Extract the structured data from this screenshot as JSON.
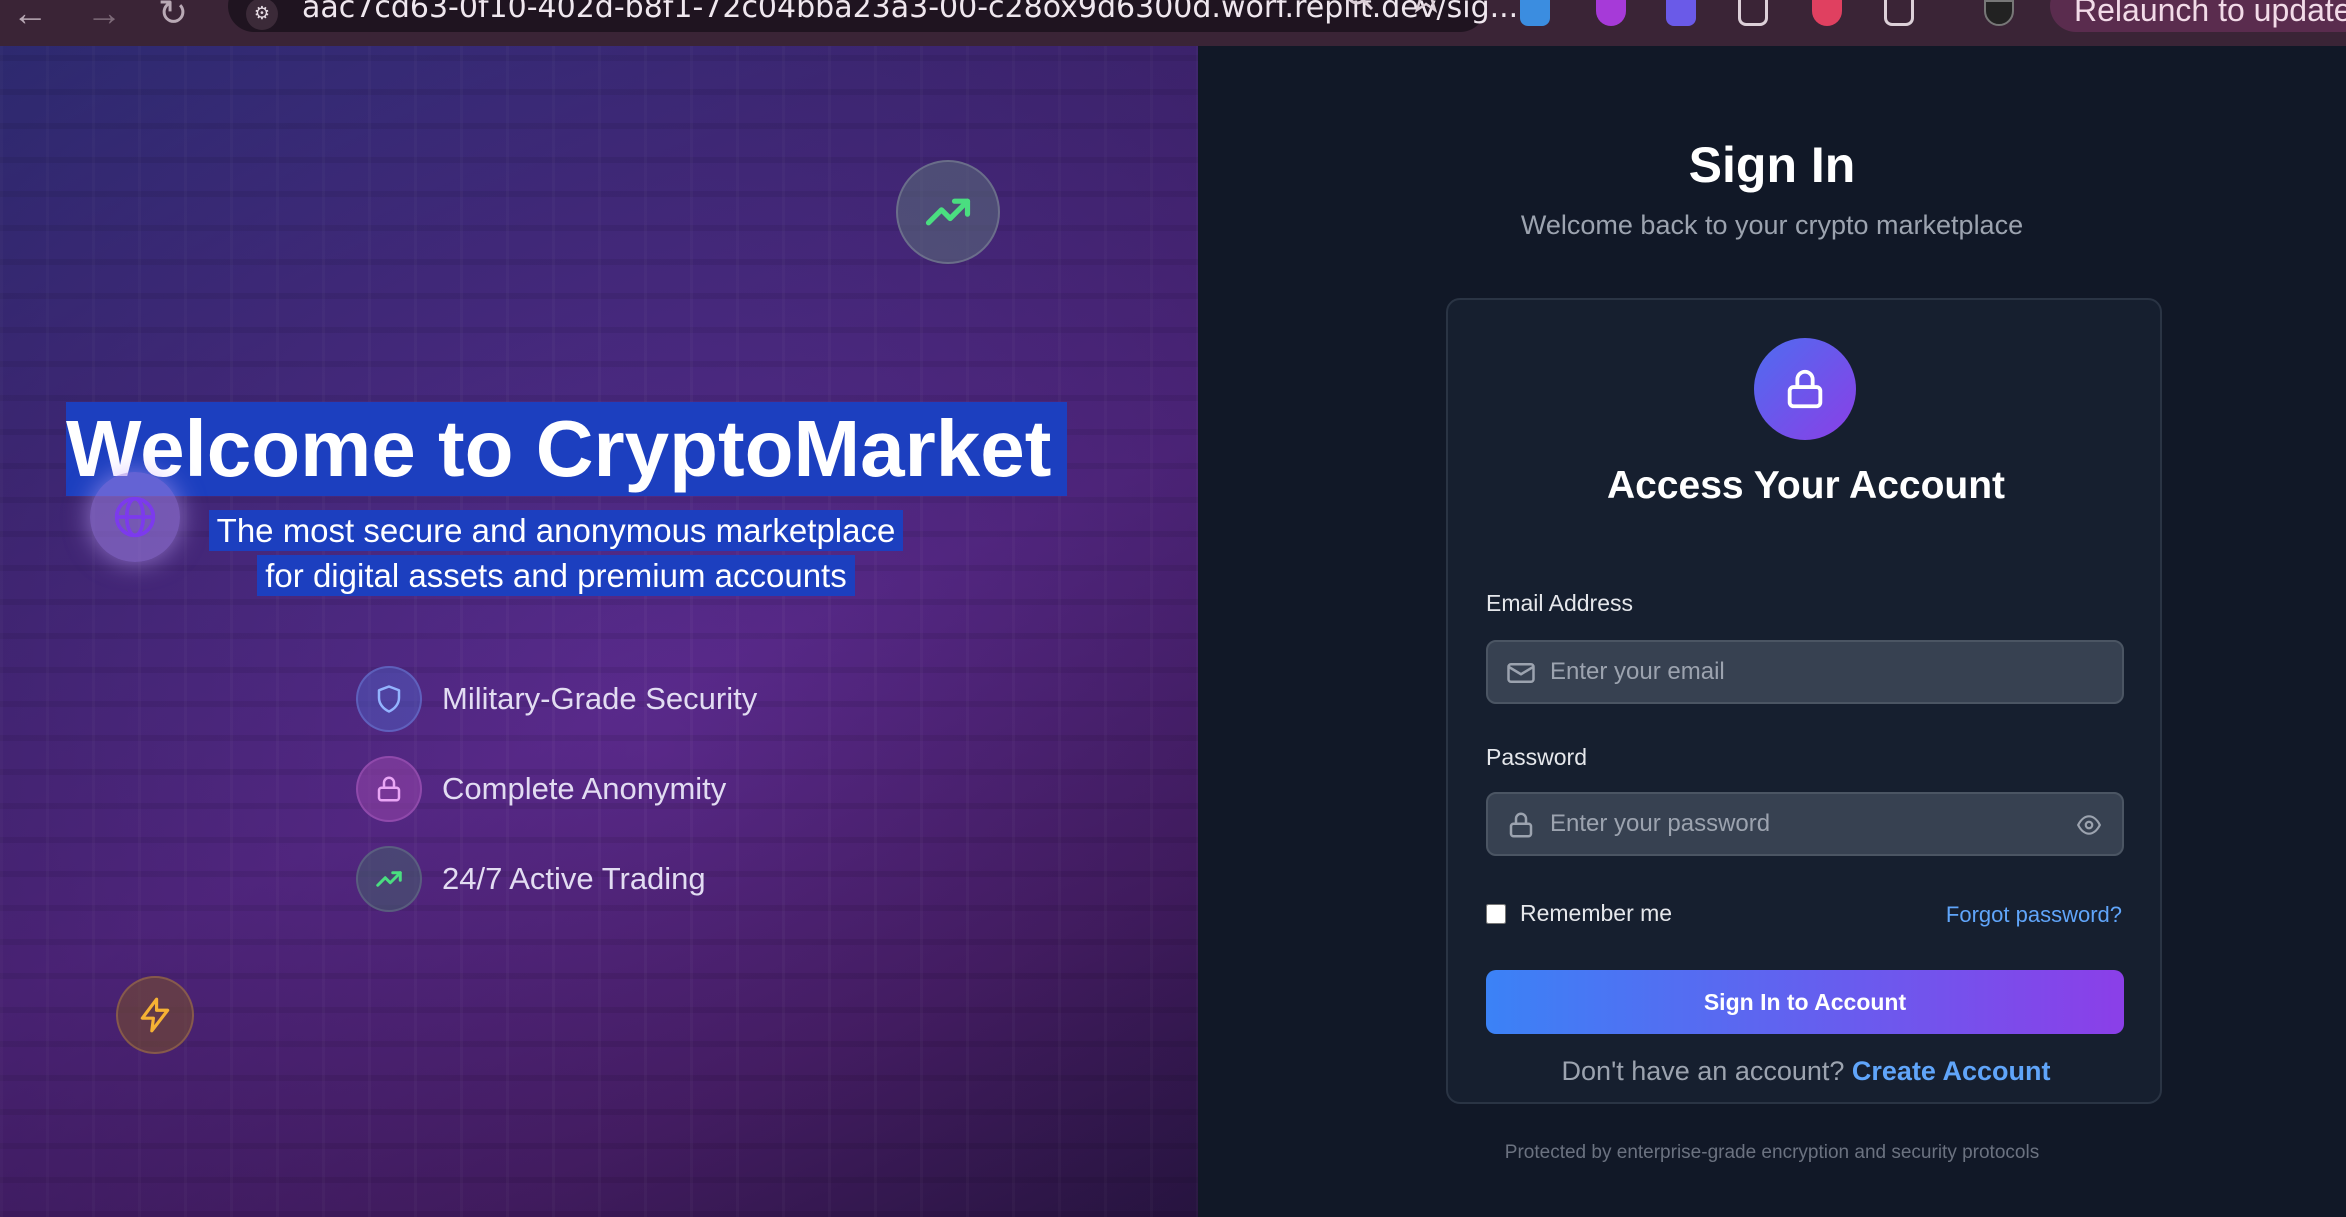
{
  "browser": {
    "url": "aac7cd63-0f10-402d-b8f1-72c04bba23a3-00-c28ox9d6300d.worf.replit.dev/sig...",
    "relaunch_label": "Relaunch to update",
    "back_glyph": "←",
    "forward_glyph": "→",
    "reload_glyph": "↻",
    "site_info_glyph": "⚙"
  },
  "hero": {
    "title": "Welcome to CryptoMarket",
    "subtitle_line1": "The most secure and anonymous marketplace",
    "subtitle_line2": "for digital assets and premium accounts",
    "features": [
      {
        "label": "Military-Grade Security",
        "icon": "shield-icon"
      },
      {
        "label": "Complete Anonymity",
        "icon": "lock-icon"
      },
      {
        "label": "24/7 Active Trading",
        "icon": "trending-up-icon"
      }
    ]
  },
  "signin": {
    "title": "Sign In",
    "subtitle": "Welcome back to your crypto marketplace",
    "card_title": "Access Your Account",
    "email_label": "Email Address",
    "email_placeholder": "Enter your email",
    "email_value": "",
    "password_label": "Password",
    "password_placeholder": "Enter your password",
    "password_value": "",
    "remember_label": "Remember me",
    "remember_checked": false,
    "forgot_label": "Forgot password?",
    "submit_label": "Sign In to Account",
    "signup_prompt": "Don't have an account?",
    "signup_link": "Create Account",
    "footer": "Protected by enterprise-grade encryption and security protocols"
  },
  "colors": {
    "accent_blue": "#3b82f6",
    "accent_purple": "#8b3fe8",
    "link": "#60a5fa",
    "panel_bg": "#111827",
    "selection": "#1c3fbf"
  }
}
